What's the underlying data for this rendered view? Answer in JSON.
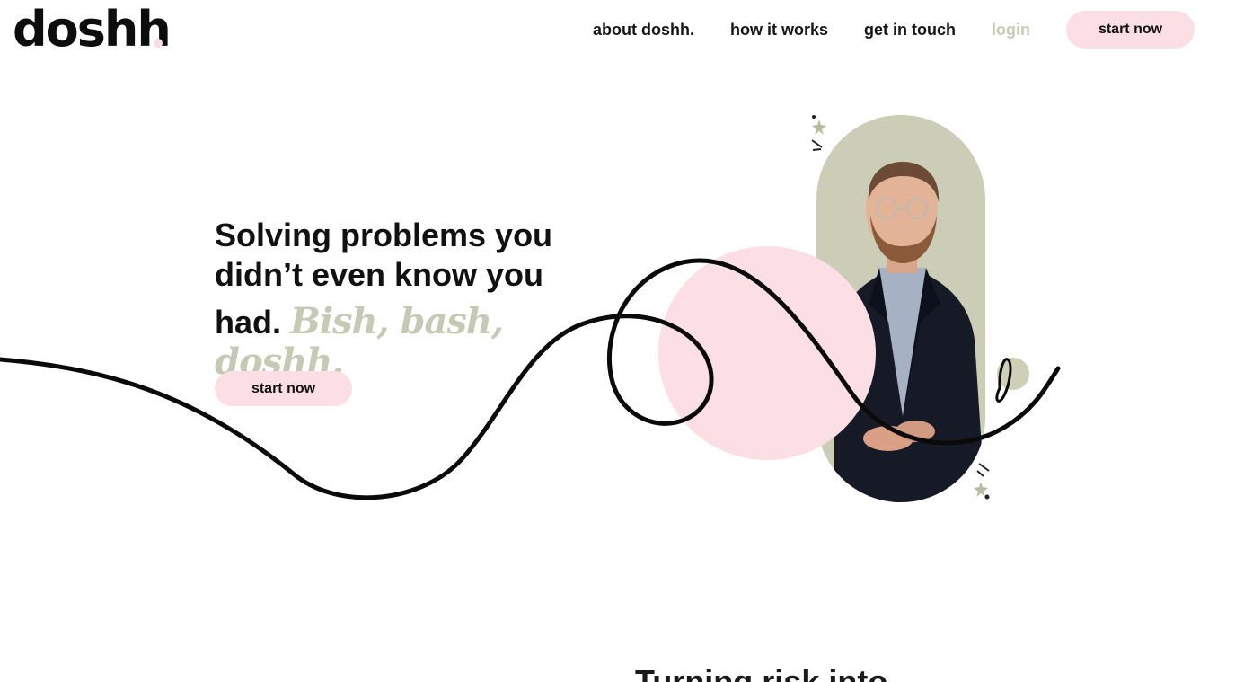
{
  "header": {
    "logo_text": "doshh",
    "nav": {
      "about": "about doshh.",
      "how": "how it works",
      "contact": "get in touch",
      "login": "login"
    },
    "cta_label": "start now"
  },
  "hero": {
    "title_line1": "Solving problems you",
    "title_line2": "didn’t even know you",
    "title_line3": "had.",
    "script_text": "Bish, bash, doshh.",
    "cta_label": "start now"
  },
  "next_section": {
    "title": "Turning risk into"
  },
  "colors": {
    "pink": "#fbdfe4",
    "olive": "#cbcdb6",
    "login": "#c8ccb4",
    "text": "#111111"
  }
}
